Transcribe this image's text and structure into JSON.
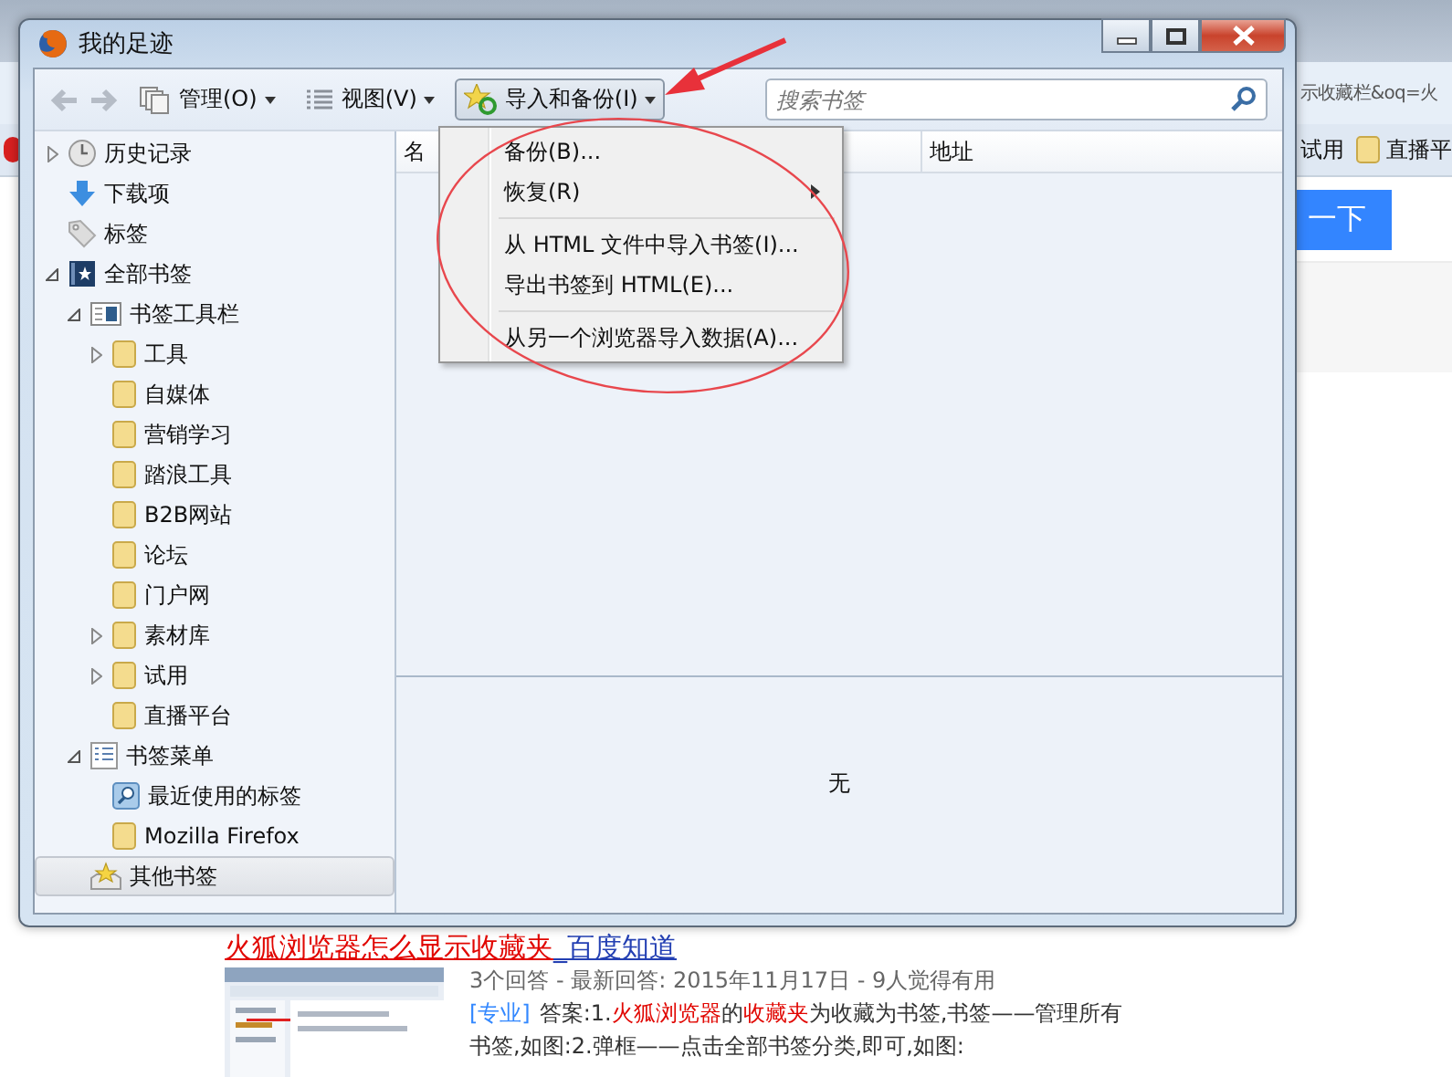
{
  "browser": {
    "address_fragment": "示收藏栏&oq=火",
    "bookmarks": [
      {
        "label": "试用",
        "kind": "text"
      },
      {
        "label": "直播平",
        "kind": "folder"
      }
    ],
    "search_button": "一下",
    "result": {
      "title": "火狐浏览器怎么显示收藏夹",
      "source": "_百度知道",
      "meta": "3个回答 - 最新回答: 2015年11月17日 - 9人觉得有用",
      "tag": "[专业]",
      "answer_lines": [
        [
          {
            "text": "答案:1.",
            "highlight": false
          },
          {
            "text": "火狐浏览器",
            "highlight": true
          },
          {
            "text": "的",
            "highlight": false
          },
          {
            "text": "收藏夹",
            "highlight": true
          },
          {
            "text": "为收藏为书签,书签——管理所有",
            "highlight": false
          }
        ],
        [
          {
            "text": "书签,如图:2.弹框——点击全部书签分类,即可,如图:",
            "highlight": false
          }
        ]
      ]
    }
  },
  "library": {
    "title": "我的足迹",
    "toolbar": {
      "organize": "管理(O)",
      "views": "视图(V)",
      "import": "导入和备份(I)",
      "search_placeholder": "搜索书签"
    },
    "tree": [
      {
        "label": "历史记录",
        "kind": "history",
        "expanded": false,
        "selected": false
      },
      {
        "label": "下载项",
        "kind": "downloads",
        "selected": false
      },
      {
        "label": "标签",
        "kind": "tags",
        "selected": false
      },
      {
        "label": "全部书签",
        "kind": "all",
        "expanded": true,
        "selected": false,
        "children": [
          {
            "label": "书签工具栏",
            "kind": "toolbar",
            "expanded": true,
            "selected": false,
            "children": [
              {
                "label": "工具",
                "kind": "folder",
                "expanded": false,
                "selected": false
              },
              {
                "label": "自媒体",
                "kind": "folder",
                "selected": false
              },
              {
                "label": "营销学习",
                "kind": "folder",
                "selected": false
              },
              {
                "label": "踏浪工具",
                "kind": "folder",
                "selected": false
              },
              {
                "label": "B2B网站",
                "kind": "folder",
                "selected": false
              },
              {
                "label": "论坛",
                "kind": "folder",
                "selected": false
              },
              {
                "label": "门户网",
                "kind": "folder",
                "selected": false
              },
              {
                "label": "素材库",
                "kind": "folder",
                "expanded": false,
                "selected": false
              },
              {
                "label": "试用",
                "kind": "folder",
                "expanded": false,
                "selected": false
              },
              {
                "label": "直播平台",
                "kind": "folder",
                "selected": false
              }
            ]
          },
          {
            "label": "书签菜单",
            "kind": "menu",
            "expanded": true,
            "selected": false,
            "children": [
              {
                "label": "最近使用的标签",
                "kind": "query",
                "selected": false
              },
              {
                "label": "Mozilla Firefox",
                "kind": "folder",
                "selected": false
              }
            ]
          },
          {
            "label": "其他书签",
            "kind": "unsorted",
            "selected": true
          }
        ]
      }
    ],
    "columns": [
      "名",
      "地址"
    ],
    "details": "无",
    "menu": [
      {
        "kind": "item",
        "label": "备份(B)...",
        "submenu": false
      },
      {
        "kind": "item",
        "label": "恢复(R)",
        "submenu": true
      },
      {
        "kind": "separator"
      },
      {
        "kind": "item",
        "label": "从 HTML 文件中导入书签(I)...",
        "submenu": false
      },
      {
        "kind": "item",
        "label": "导出书签到 HTML(E)...",
        "submenu": false
      },
      {
        "kind": "separator"
      },
      {
        "kind": "item",
        "label": "从另一个浏览器导入数据(A)...",
        "submenu": false
      }
    ]
  }
}
